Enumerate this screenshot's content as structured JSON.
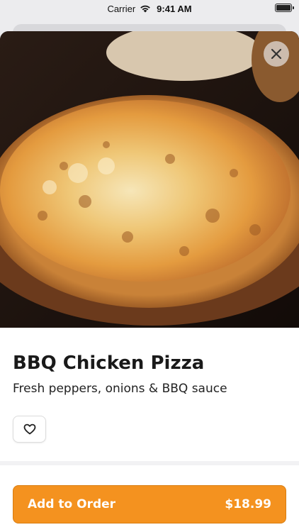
{
  "status_bar": {
    "carrier": "Carrier",
    "time": "9:41 AM"
  },
  "item": {
    "name": "BBQ Chicken Pizza",
    "description": "Fresh peppers, onions & BBQ sauce"
  },
  "order_button": {
    "label": "Add to Order",
    "price": "$18.99"
  },
  "icons": {
    "close": "close-icon",
    "favorite": "heart-icon",
    "wifi": "wifi-icon",
    "battery": "battery-icon"
  },
  "colors": {
    "accent": "#f4921f",
    "accent_border": "#d97d10"
  }
}
